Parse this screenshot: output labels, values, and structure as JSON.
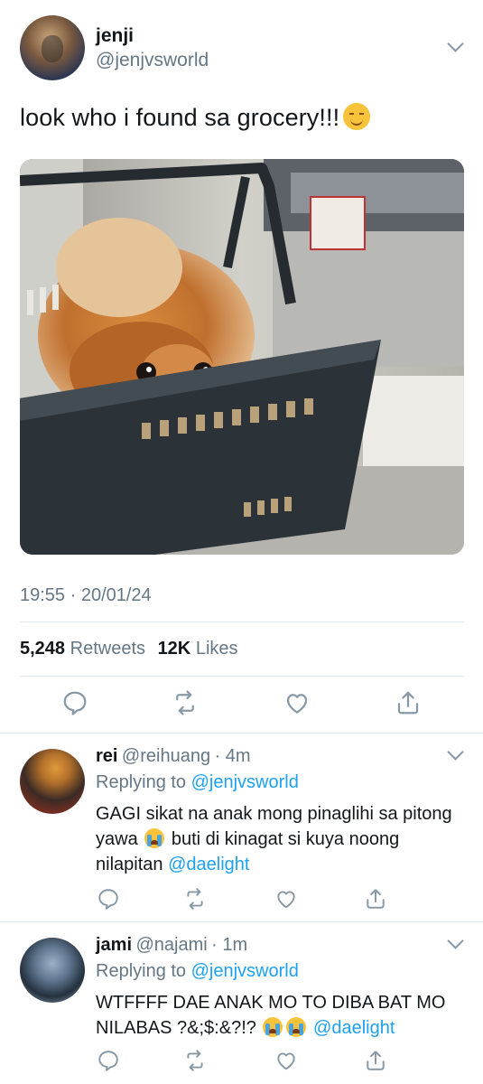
{
  "tweet": {
    "author": {
      "name": "jenji",
      "handle": "@jenjvsworld"
    },
    "text": "look who i found sa grocery!!!",
    "emoji": "smiling-face-emoji",
    "timestamp": "19:55 · 20/01/24",
    "stats": {
      "retweets_count": "5,248",
      "retweets_label": "Retweets",
      "likes_count": "12K",
      "likes_label": "Likes"
    }
  },
  "actions": [
    "reply-icon",
    "retweet-icon",
    "like-icon",
    "share-icon"
  ],
  "replies": [
    {
      "name": "rei",
      "handle": "@reihuang",
      "time": "· 4m",
      "replying_prefix": "Replying to",
      "replying_to": "@jenjvsworld",
      "text_part1": "GAGI sikat na anak mong pinaglihi sa pitong yawa",
      "text_part2": "buti di kinagat si kuya noong nilapitan",
      "mention": "@daelight"
    },
    {
      "name": "jami",
      "handle": "@najami",
      "time": "· 1m",
      "replying_prefix": "Replying to",
      "replying_to": "@jenjvsworld",
      "text_part1": "WTFFFF DAE ANAK MO TO DIBA BAT MO NILABAS ?&;$:&?!?",
      "mention": "@daelight"
    }
  ],
  "colors": {
    "link": "#1da1f2",
    "secondary_text": "#657786",
    "icon": "#8899a6",
    "divider": "#e1e8ed"
  }
}
